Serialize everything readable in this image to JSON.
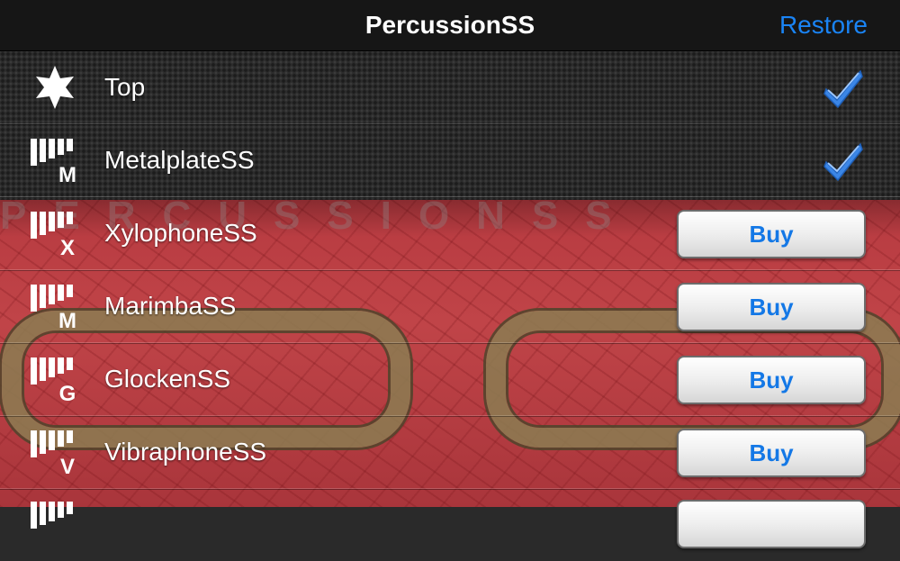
{
  "navbar": {
    "title": "PercussionSS",
    "restore_label": "Restore"
  },
  "decoration": {
    "banner_text": "PERCUSSIONSS"
  },
  "items": [
    {
      "label": "Top",
      "icon": "star-icon",
      "status": "purchased"
    },
    {
      "label": "MetalplateSS",
      "icon": "metalplate-icon",
      "letter": "M",
      "status": "purchased"
    },
    {
      "label": "XylophoneSS",
      "icon": "xylophone-icon",
      "letter": "X",
      "status": "buy",
      "buy_label": "Buy"
    },
    {
      "label": "MarimbaSS",
      "icon": "marimba-icon",
      "letter": "M",
      "status": "buy",
      "buy_label": "Buy"
    },
    {
      "label": "GlockenSS",
      "icon": "glocken-icon",
      "letter": "G",
      "status": "buy",
      "buy_label": "Buy"
    },
    {
      "label": "VibraphoneSS",
      "icon": "vibraphone-icon",
      "letter": "V",
      "status": "buy",
      "buy_label": "Buy"
    }
  ],
  "colors": {
    "accent": "#1a84f5",
    "buy_text": "#1478e6",
    "check": "#3b86e6",
    "red_bg": "#b73a40"
  }
}
